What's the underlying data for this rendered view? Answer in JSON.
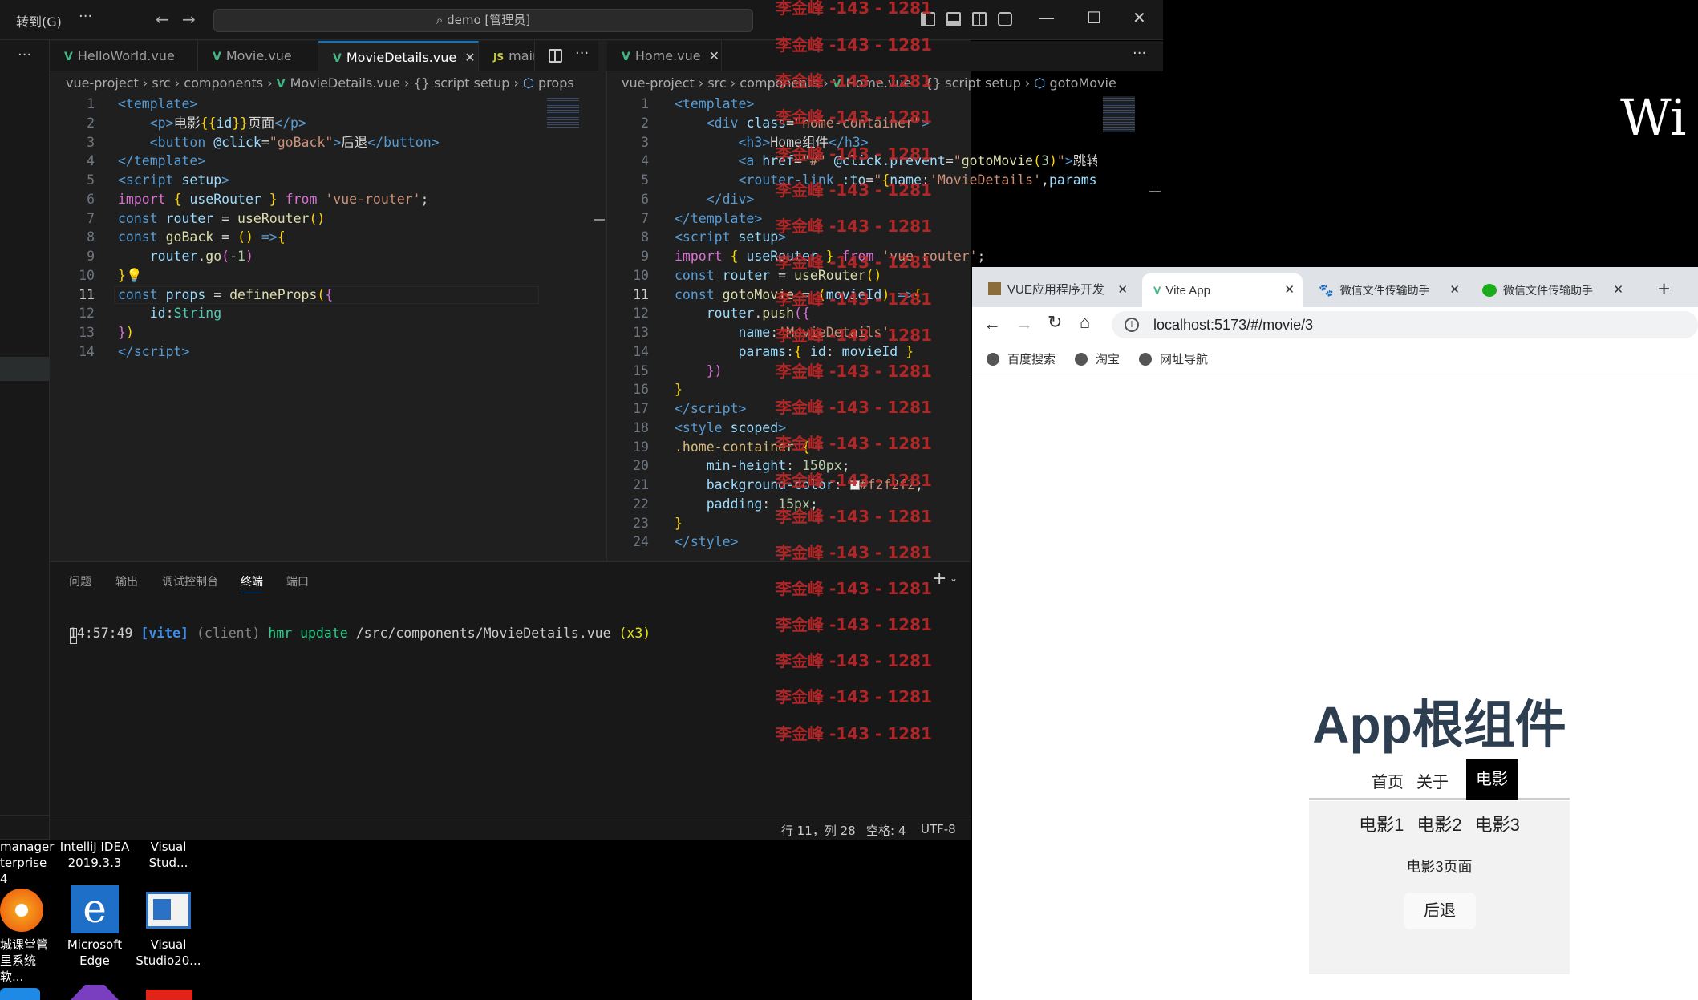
{
  "vscode": {
    "menu_goto": "转到(G)",
    "menu_more": "···",
    "search_text": "demo [管理员]",
    "tabs_left": [
      {
        "label": "HelloWorld.vue"
      },
      {
        "label": "Movie.vue"
      },
      {
        "label": "MovieDetails.vue"
      },
      {
        "label": "main.js"
      }
    ],
    "tabs_right": [
      {
        "label": "Home.vue"
      }
    ],
    "breadcrumb_left": [
      "vue-project",
      "src",
      "components",
      "MovieDetails.vue",
      "{} script setup",
      "props"
    ],
    "breadcrumb_right": [
      "vue-project",
      "src",
      "components",
      "Home.vue",
      "{} script setup",
      "gotoMovie"
    ],
    "left_line_numbers": [
      "1",
      "2",
      "3",
      "4",
      "5",
      "6",
      "7",
      "8",
      "9",
      "10",
      "11",
      "12",
      "13",
      "14"
    ],
    "right_line_numbers": [
      "1",
      "2",
      "3",
      "4",
      "5",
      "6",
      "7",
      "8",
      "9",
      "10",
      "11",
      "12",
      "13",
      "14",
      "15",
      "16",
      "17",
      "18",
      "19",
      "20",
      "21",
      "22",
      "23",
      "24"
    ],
    "panel_tabs": [
      "问题",
      "输出",
      "调试控制台",
      "终端",
      "端口"
    ],
    "terminal": {
      "time": "14:57:49",
      "tag": "[vite]",
      "client": "(client)",
      "hmr": "hmr update",
      "path": "/src/components/MovieDetails.vue",
      "count": "(x3)"
    },
    "status": {
      "position": "行 11，列 28",
      "spaces": "空格: 4",
      "encoding": "UTF-8"
    }
  },
  "watermark": "李金峰 -143 - 1281",
  "desktop": {
    "partial_title": "Wi",
    "icons": [
      {
        "label1": "manager",
        "label2": "terprise 4"
      },
      {
        "label1": "IntelliJ IDEA",
        "label2": "2019.3.3"
      },
      {
        "label1": "Visual",
        "label2": "Stud..."
      },
      {
        "label1": "城课堂管",
        "label2": "里系统软..."
      },
      {
        "label1": "Microsoft",
        "label2": "Edge"
      },
      {
        "label1": "Visual",
        "label2": "Studio20..."
      }
    ]
  },
  "browser": {
    "tabs": [
      {
        "label": "VUE应用程序开发"
      },
      {
        "label": "Vite App"
      },
      {
        "label": "微信文件传输助手"
      },
      {
        "label": "微信文件传输助手"
      }
    ],
    "url": "localhost:5173/#/movie/3",
    "bookmarks": [
      "百度搜索",
      "淘宝",
      "网址导航"
    ],
    "app": {
      "title": "App根组件",
      "nav": [
        "首页",
        "关于",
        "电影"
      ],
      "movies": [
        "电影1",
        "电影2",
        "电影3"
      ],
      "page_text": "电影3页面",
      "back_button": "后退"
    }
  },
  "colors": {
    "editor_bg": "#1f1f1f",
    "accent": "#0078d4",
    "vue_green": "#41b883",
    "watermark_red": "#c0282a"
  }
}
